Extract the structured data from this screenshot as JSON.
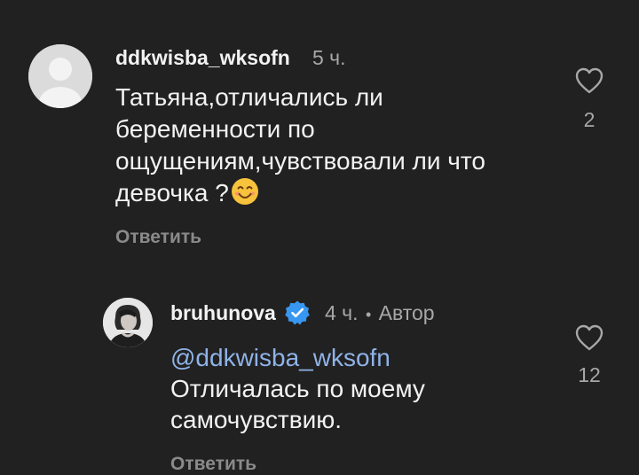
{
  "comments": [
    {
      "username": "ddkwisba_wksofn",
      "time": "5 ч.",
      "lines": [
        "Татьяна,отличались ли",
        "беременности по",
        "ощущениям,чувствовали ли что",
        "девочка ?"
      ],
      "emoji": "😊",
      "reply_label": "Ответить",
      "likes": "2"
    },
    {
      "username": "bruhunova",
      "time": "4 ч.",
      "separator": "•",
      "author_badge": "Автор",
      "mention": "@ddkwisba_wksofn",
      "lines": [
        "Отличалась по моему",
        "самочувствию."
      ],
      "reply_label": "Ответить",
      "likes": "12"
    }
  ],
  "colors": {
    "background": "#212121",
    "mention": "#8fb3e8",
    "verified": "#3897f0"
  },
  "icons": {
    "like": "heart-outline-icon",
    "verified": "verified-badge-icon"
  }
}
